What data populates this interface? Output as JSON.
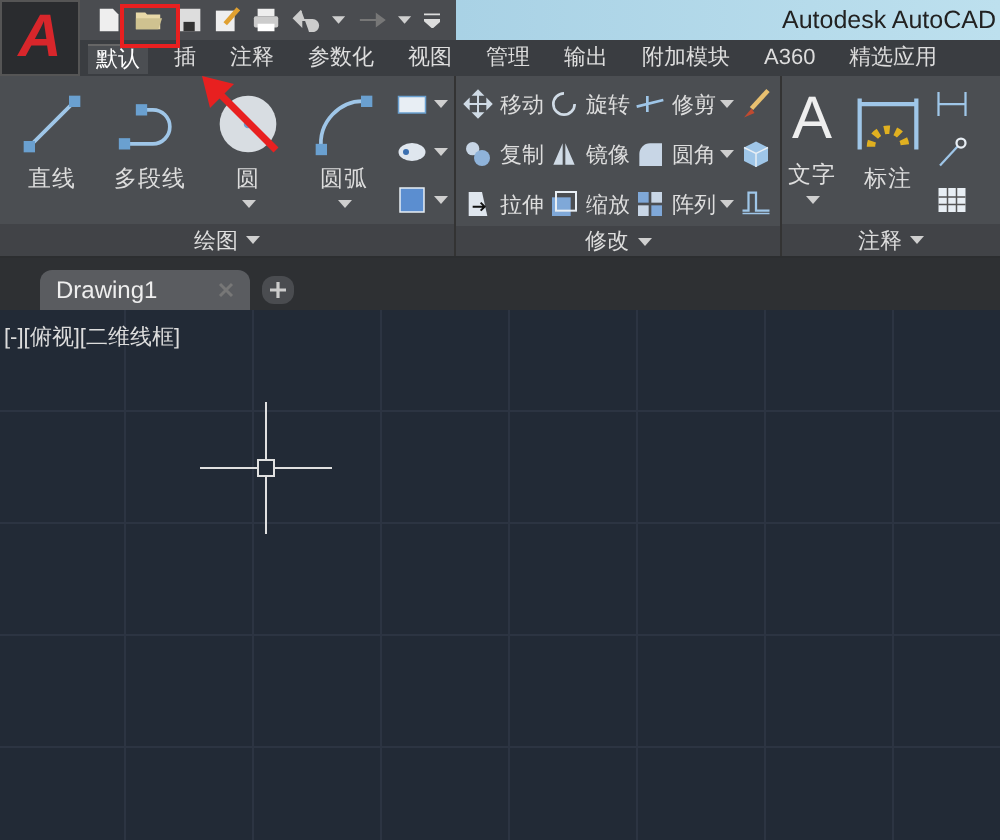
{
  "app_button": {
    "glyph": "A"
  },
  "title_bar": {
    "title": "Autodesk AutoCAD"
  },
  "tabs": [
    {
      "label": "默认",
      "selected": true
    },
    {
      "label": "插",
      "selected": false
    },
    {
      "label": "注释",
      "selected": false
    },
    {
      "label": "参数化",
      "selected": false
    },
    {
      "label": "视图",
      "selected": false
    },
    {
      "label": "管理",
      "selected": false
    },
    {
      "label": "输出",
      "selected": false
    },
    {
      "label": "附加模块",
      "selected": false
    },
    {
      "label": "A360",
      "selected": false
    },
    {
      "label": "精选应用",
      "selected": false
    }
  ],
  "panels": [
    {
      "title": "绘图",
      "columns": [
        [
          {
            "kind": "large",
            "label": "直线",
            "dropdown": false
          }
        ],
        [
          {
            "kind": "large",
            "label": "多段线",
            "dropdown": false
          }
        ],
        [
          {
            "kind": "large",
            "label": "圆",
            "dropdown": true
          }
        ],
        [
          {
            "kind": "large",
            "label": "圆弧",
            "dropdown": true
          }
        ],
        [
          {
            "kind": "icon",
            "dropdown": true
          },
          {
            "kind": "icon",
            "dropdown": true
          },
          {
            "kind": "icon",
            "dropdown": true
          }
        ]
      ]
    },
    {
      "title": "修改",
      "columns": [
        [
          {
            "kind": "small",
            "label": "移动",
            "dropdown": false
          },
          {
            "kind": "small",
            "label": "复制",
            "dropdown": false
          },
          {
            "kind": "small",
            "label": "拉伸",
            "dropdown": false
          }
        ],
        [
          {
            "kind": "small",
            "label": "旋转",
            "dropdown": false
          },
          {
            "kind": "small",
            "label": "镜像",
            "dropdown": false
          },
          {
            "kind": "small",
            "label": "缩放",
            "dropdown": false
          }
        ],
        [
          {
            "kind": "small",
            "label": "修剪",
            "dropdown": true
          },
          {
            "kind": "small",
            "label": "圆角",
            "dropdown": true
          },
          {
            "kind": "small",
            "label": "阵列",
            "dropdown": true
          }
        ],
        [
          {
            "kind": "icon",
            "dropdown": false
          },
          {
            "kind": "icon",
            "dropdown": false
          },
          {
            "kind": "icon",
            "dropdown": false
          }
        ]
      ]
    },
    {
      "title": "注释",
      "columns": [
        [
          {
            "kind": "glyph",
            "glyph": "A",
            "label": "文字",
            "dropdown": true
          }
        ],
        [
          {
            "kind": "large",
            "label": "标注",
            "dropdown": false
          }
        ],
        [
          {
            "kind": "icon",
            "dropdown": false
          },
          {
            "kind": "icon",
            "dropdown": false
          },
          {
            "kind": "icon",
            "dropdown": false
          }
        ]
      ]
    }
  ],
  "file_tabs": [
    {
      "label": "Drawing1",
      "selected": true
    }
  ],
  "viewport": {
    "label": "[-][俯视][二维线框]"
  },
  "annotation": {
    "highlight": true,
    "arrow": true
  }
}
